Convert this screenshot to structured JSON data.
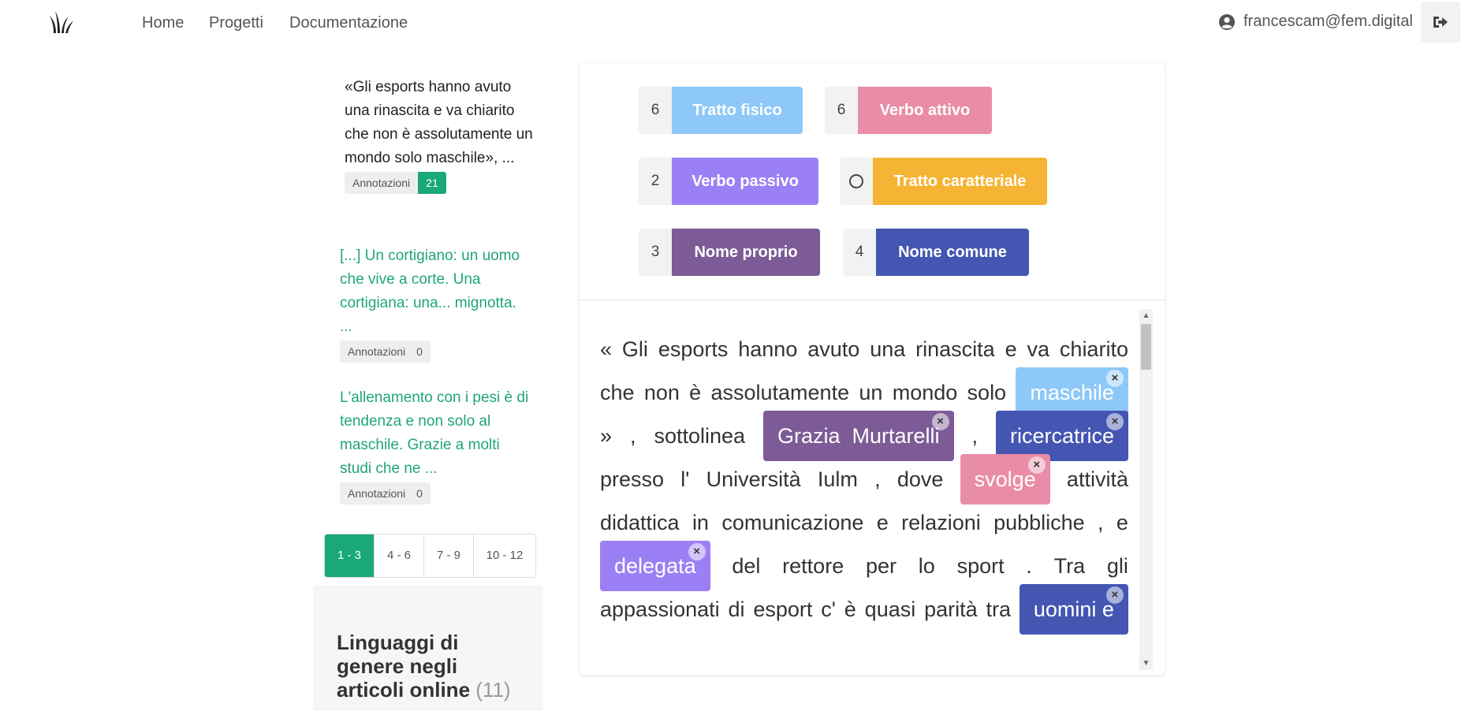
{
  "nav": {
    "links": [
      "Home",
      "Progetti",
      "Documentazione"
    ],
    "user_email": "francescam@fem.digital"
  },
  "documents": [
    {
      "text": "«Gli esports hanno avuto una rinascita e va chiarito che non è assolutamente un mondo solo maschile», ...",
      "badge_label": "Annotazioni",
      "badge_count": "21",
      "active": true
    },
    {
      "text": "[...] Un cortigiano: un uomo che vive a corte. Una cortigiana: una... mignotta. ...",
      "badge_label": "Annotazioni",
      "badge_count": "0",
      "active": false
    },
    {
      "text": "L'allenamento con i pesi è di tendenza e non solo al maschile. Grazie a molti studi che ne ...",
      "badge_label": "Annotazioni",
      "badge_count": "0",
      "active": false
    }
  ],
  "pagination": [
    "1 - 3",
    "4 - 6",
    "7 - 9",
    "10 - 12"
  ],
  "project": {
    "title": "Linguaggi di genere negli articoli online",
    "count": "(11)"
  },
  "labels": [
    {
      "key": "6",
      "name": "Tratto fisico",
      "color": "#8ec8f8"
    },
    {
      "key": "6",
      "name": "Verbo attivo",
      "color": "#e98ca7"
    },
    {
      "key": "2",
      "name": "Verbo passivo",
      "color": "#9b80f5"
    },
    {
      "key": "",
      "name": "Tratto caratteriale",
      "color": "#f5b433"
    },
    {
      "key": "3",
      "name": "Nome proprio",
      "color": "#7c5b96"
    },
    {
      "key": "4",
      "name": "Nome comune",
      "color": "#4456b2"
    }
  ],
  "text_lines": [
    {
      "words": [
        "«",
        "Gli",
        "esports",
        "hanno",
        "avuto",
        "una",
        "rinascita",
        "e",
        "va",
        "chiarito"
      ]
    },
    {
      "words": [
        "che",
        "non",
        "è",
        "assolutamente",
        "un",
        "mondo",
        "solo",
        {
          "ann": "maschile",
          "color": "#8ec8f8"
        }
      ]
    },
    {
      "words": [
        "»",
        ",",
        "sottolinea",
        {
          "ann": "Grazia  Murtarelli",
          "color": "#7c5b96"
        },
        ",",
        {
          "ann": "ricercatrice",
          "color": "#4456b2"
        }
      ]
    },
    {
      "words": [
        "presso",
        "l'",
        "Università",
        "Iulm",
        ",",
        "dove",
        {
          "ann": "svolge",
          "color": "#e98ca7"
        },
        "attività"
      ]
    },
    {
      "words": [
        "didattica",
        "in",
        "comunicazione",
        "e",
        "relazioni",
        "pubbliche",
        ",",
        "e"
      ]
    },
    {
      "words": [
        {
          "ann": "delegata",
          "color": "#9b80f5"
        },
        "del",
        "rettore",
        "per",
        "lo",
        "sport",
        ".",
        "Tra",
        "gli"
      ]
    },
    {
      "words": [
        "appassionati",
        "di",
        "esport",
        "c'",
        "è",
        "quasi",
        "parità",
        "tra",
        {
          "ann": "uomini e",
          "color": "#4456b2"
        }
      ]
    }
  ],
  "icons": {
    "logo": "grass-logo-icon",
    "user": "user-circle-icon",
    "logout": "sign-out-icon",
    "remove": "close-icon",
    "scroll_up": "caret-up-icon",
    "scroll_down": "caret-down-icon",
    "no_key": "circle-icon"
  },
  "remove_glyph": "×"
}
